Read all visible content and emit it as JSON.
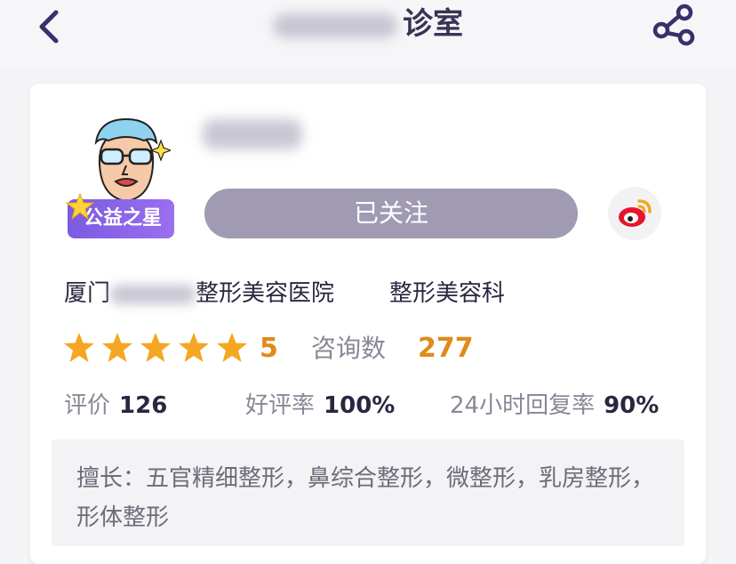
{
  "header": {
    "title_suffix": "诊室",
    "back_icon": "chevron-left-icon",
    "share_icon": "share-icon"
  },
  "doctor": {
    "badge": "公益之星",
    "follow_label": "已关注",
    "weibo_icon": "weibo-icon",
    "hospital_prefix": "厦门",
    "hospital_suffix": "整形美容医院",
    "department": "整形美容科"
  },
  "ratings": {
    "stars": 5,
    "score": "5",
    "consult_label": "咨询数",
    "consult_count": "277"
  },
  "stats": {
    "review_label": "评价",
    "review_count": "126",
    "good_rate_label": "好评率",
    "good_rate": "100%",
    "reply_rate_label": "24小时回复率",
    "reply_rate": "90%"
  },
  "specialty": {
    "text": "擅长：五官精细整形，鼻综合整形，微整形，乳房整形，形体整形"
  },
  "colors": {
    "accent_orange": "#e08a19",
    "follow_gray": "#a09ab3",
    "badge_purple": "#7b5be0",
    "title_dark": "#3a3355"
  }
}
